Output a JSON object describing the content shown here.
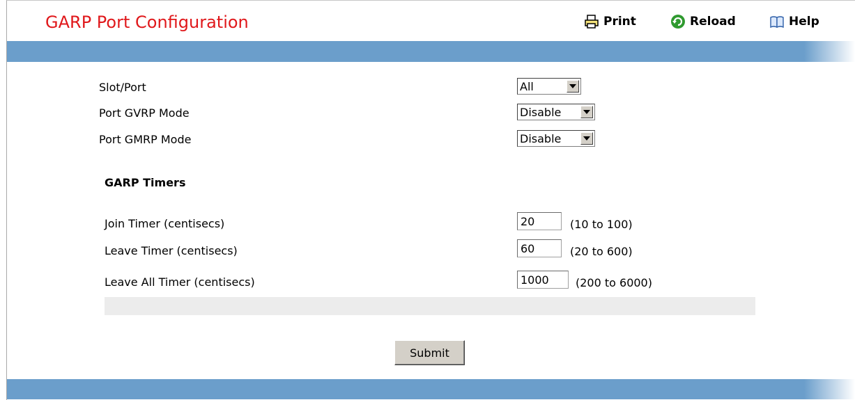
{
  "header": {
    "title": "GARP Port Configuration",
    "print_label": "Print",
    "reload_label": "Reload",
    "help_label": "Help"
  },
  "form": {
    "slot_port": {
      "label": "Slot/Port",
      "value": "All"
    },
    "gvrp_mode": {
      "label": "Port GVRP Mode",
      "value": "Disable"
    },
    "gmrp_mode": {
      "label": "Port GMRP Mode",
      "value": "Disable"
    }
  },
  "timers": {
    "section_title": "GARP Timers",
    "join": {
      "label": "Join Timer (centisecs)",
      "value": "20",
      "range": "(10 to 100)"
    },
    "leave": {
      "label": "Leave Timer (centisecs)",
      "value": "60",
      "range": "(20 to 600)"
    },
    "leave_all": {
      "label": "Leave All Timer (centisecs)",
      "value": "1000",
      "range": "(200 to 6000)"
    }
  },
  "submit_label": "Submit",
  "colors": {
    "title": "#e0181b",
    "band": "#6b9ecb"
  },
  "icons": {
    "print": "printer-icon",
    "reload": "reload-icon",
    "help": "book-icon"
  }
}
